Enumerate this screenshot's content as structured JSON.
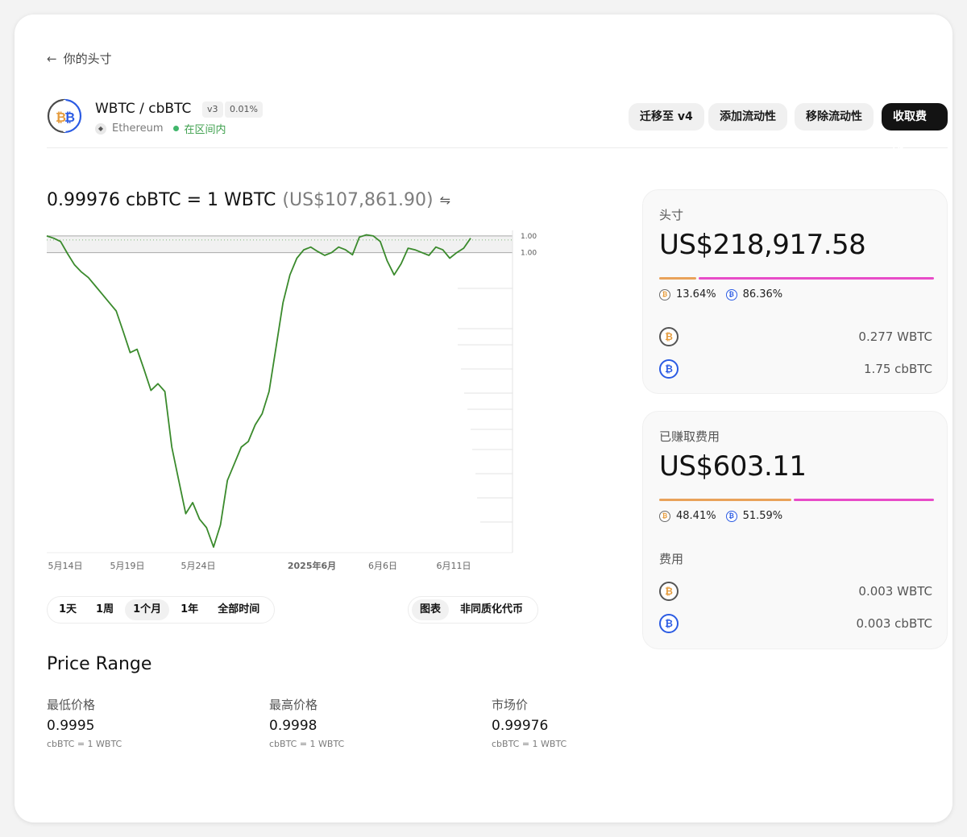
{
  "nav": {
    "back_label": "你的头寸"
  },
  "pair": {
    "title": "WBTC / cbBTC",
    "version": "v3",
    "fee_tier": "0.01%",
    "network": "Ethereum",
    "status": "在区间内",
    "status_color": "#40a14f"
  },
  "actions": {
    "migrate": "迁移至 v4",
    "add_liquidity": "添加流动性",
    "remove_liquidity": "移除流动性",
    "collect_fees": "收取费用"
  },
  "price_header": {
    "rate": "0.99976 cbBTC = 1 WBTC",
    "usd": "(US$107,861.90)"
  },
  "chart_data": {
    "type": "line",
    "x_tick_labels": [
      "5月14日",
      "5月19日",
      "5月24日",
      "2025年6月",
      "6月6日",
      "6月11日"
    ],
    "y_tick_labels": [
      "1.00",
      "1.00"
    ],
    "range_band": {
      "min": 0.9995,
      "max": 0.9998
    },
    "series": [
      {
        "color": "#3a8a2c",
        "x_start": "2025-05-13",
        "x_end": "2025-06-13",
        "values": [
          0.9998,
          0.99976,
          0.9997,
          0.99948,
          0.99928,
          0.99915,
          0.99905,
          0.9989,
          0.99875,
          0.9986,
          0.99845,
          0.99808,
          0.9977,
          0.99776,
          0.9974,
          0.99702,
          0.99714,
          0.997,
          0.996,
          0.9954,
          0.9948,
          0.995,
          0.9947,
          0.99455,
          0.9942,
          0.9946,
          0.9954,
          0.9957,
          0.996,
          0.9961,
          0.9964,
          0.9966,
          0.997,
          0.9978,
          0.9986,
          0.9991,
          0.9994,
          0.99955,
          0.9996,
          0.99952,
          0.99945,
          0.9995,
          0.9996,
          0.99955,
          0.99946,
          0.99978,
          0.99982,
          0.9998,
          0.9997,
          0.99935,
          0.9991,
          0.9993,
          0.99958,
          0.99955,
          0.9995,
          0.99945,
          0.9996,
          0.99955,
          0.9994,
          0.9995,
          0.99958,
          0.99976
        ]
      }
    ],
    "grid": false
  },
  "ranges": {
    "d1": "1天",
    "w1": "1周",
    "m1": "1个月",
    "y1": "1年",
    "all": "全部时间",
    "active": "1个月"
  },
  "views": {
    "chart": "图表",
    "nft": "非同质化代币",
    "active": "图表"
  },
  "price_range": {
    "title": "Price Range",
    "unit": "cbBTC = 1 WBTC",
    "min_label": "最低价格",
    "min_value": "0.9995",
    "max_label": "最高价格",
    "max_value": "0.9998",
    "market_label": "市场价",
    "market_value": "0.99976"
  },
  "position": {
    "title": "头寸",
    "value": "US$218,917.58",
    "wbtc_share": 13.64,
    "cbbtc_share": 86.36,
    "wbtc_pct": "13.64%",
    "cbbtc_pct": "86.36%",
    "wbtc_amount": "0.277 WBTC",
    "cbbtc_amount": "1.75 cbBTC"
  },
  "fees": {
    "title": "已赚取费用",
    "value": "US$603.11",
    "wbtc_share": 48.41,
    "cbbtc_share": 51.59,
    "wbtc_pct": "48.41%",
    "cbbtc_pct": "51.59%",
    "section_label": "费用",
    "wbtc_amount": "0.003 WBTC",
    "cbbtc_amount": "0.003 cbBTC"
  },
  "colors": {
    "wbtc": "#e9a25a",
    "cbbtc": "#e84cc8",
    "line": "#3a8a2c",
    "primary_button": "#131313"
  }
}
